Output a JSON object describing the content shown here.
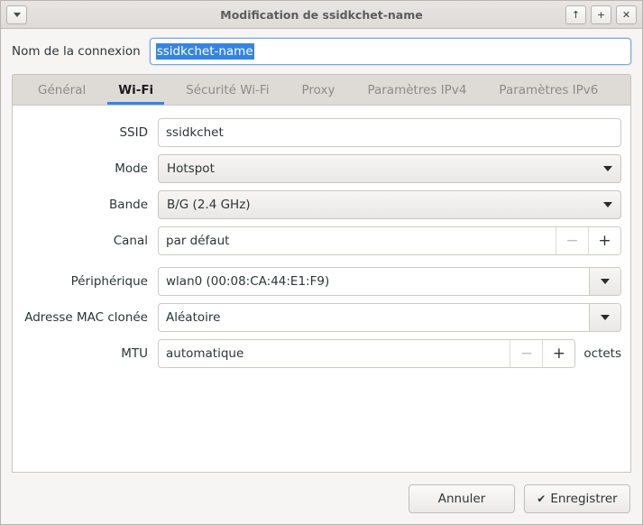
{
  "window": {
    "title": "Modification de ssidkchet-name",
    "menu_icon": "chevron-down-icon",
    "buttons": [
      {
        "name": "shade-button",
        "icon": "up-arrow-icon",
        "glyph": "↑"
      },
      {
        "name": "maximize-button",
        "icon": "plus-icon",
        "glyph": "+"
      },
      {
        "name": "close-button",
        "icon": "close-icon",
        "glyph": "✕"
      }
    ]
  },
  "connection": {
    "label": "Nom de la connexion",
    "value": "ssidkchet-name",
    "selected": true,
    "selection_color": "#3584e4"
  },
  "tabs": [
    {
      "label": "Général",
      "active": false
    },
    {
      "label": "Wi-Fi",
      "active": true
    },
    {
      "label": "Sécurité Wi-Fi",
      "active": false
    },
    {
      "label": "Proxy",
      "active": false
    },
    {
      "label": "Paramètres IPv4",
      "active": false
    },
    {
      "label": "Paramètres IPv6",
      "active": false
    }
  ],
  "active_tab_underline_color": "#3584e4",
  "form": {
    "ssid": {
      "label": "SSID",
      "value": "ssidkchet"
    },
    "mode": {
      "label": "Mode",
      "value": "Hotspot"
    },
    "bande": {
      "label": "Bande",
      "value": "B/G (2.4 GHz)"
    },
    "canal": {
      "label": "Canal",
      "value": "par défaut",
      "minus": "−",
      "plus": "+",
      "minus_enabled": false,
      "plus_enabled": true
    },
    "peripherique": {
      "label": "Périphérique",
      "value": "wlan0 (00:08:CA:44:E1:F9)"
    },
    "mac_clonee": {
      "label": "Adresse MAC clonée",
      "value": "Aléatoire"
    },
    "mtu": {
      "label": "MTU",
      "value": "automatique",
      "unit": "octets",
      "minus": "−",
      "plus": "+",
      "minus_enabled": false,
      "plus_enabled": true
    }
  },
  "actions": {
    "cancel": "Annuler",
    "save": "Enregistrer",
    "save_icon": "check-icon",
    "save_check_glyph": "✔"
  }
}
